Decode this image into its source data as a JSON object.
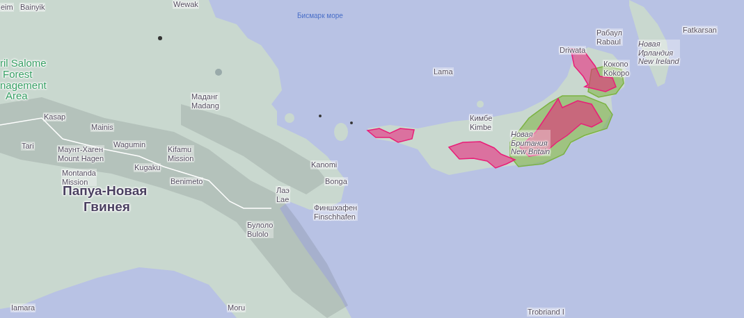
{
  "map": {
    "labels": [
      {
        "kind": "sea",
        "lines": [
          "Бисмарк море"
        ]
      },
      {
        "kind": "town",
        "lines": [
          "Wewak"
        ]
      },
      {
        "kind": "town",
        "lines": [
          "eim"
        ]
      },
      {
        "kind": "town",
        "lines": [
          "Bainyik"
        ]
      },
      {
        "kind": "park",
        "lines": [
          "ril Salome",
          "Forest",
          "nagement",
          "Area"
        ]
      },
      {
        "kind": "town",
        "lines": [
          "Маданг",
          "Madang"
        ]
      },
      {
        "kind": "town",
        "lines": [
          "Kasap"
        ]
      },
      {
        "kind": "town",
        "lines": [
          "Mainis"
        ]
      },
      {
        "kind": "town",
        "lines": [
          "Tari"
        ]
      },
      {
        "kind": "town",
        "lines": [
          "Маунт-Хаген",
          "Mount Hagen"
        ]
      },
      {
        "kind": "town",
        "lines": [
          "Wagumin"
        ]
      },
      {
        "kind": "town",
        "lines": [
          "Kifamu",
          "Mission"
        ]
      },
      {
        "kind": "town",
        "lines": [
          "Kugaku"
        ]
      },
      {
        "kind": "town",
        "lines": [
          "Montanda",
          "Mission"
        ]
      },
      {
        "kind": "town",
        "lines": [
          "Benimeto"
        ]
      },
      {
        "kind": "country",
        "lines": [
          "Папуа-Новая",
          "Гвинея"
        ]
      },
      {
        "kind": "town",
        "lines": [
          "Kanomi"
        ]
      },
      {
        "kind": "town",
        "lines": [
          "Bonga"
        ]
      },
      {
        "kind": "town",
        "lines": [
          "Лаэ",
          "Lae"
        ]
      },
      {
        "kind": "town",
        "lines": [
          "Финшхафен",
          "Finschhafen"
        ]
      },
      {
        "kind": "town",
        "lines": [
          "Булоло",
          "Bulolo"
        ]
      },
      {
        "kind": "town",
        "lines": [
          "Lama"
        ]
      },
      {
        "kind": "town",
        "lines": [
          "Кимбе",
          "Kimbe"
        ]
      },
      {
        "kind": "island",
        "lines": [
          "Новая",
          "Британия",
          "New Britain"
        ]
      },
      {
        "kind": "town",
        "lines": [
          "Рабаул",
          "Rabaul"
        ]
      },
      {
        "kind": "town",
        "lines": [
          "Driwata"
        ]
      },
      {
        "kind": "town",
        "lines": [
          "Кокопо",
          "Kokopo"
        ]
      },
      {
        "kind": "island",
        "lines": [
          "Новая",
          "Ирландия",
          "New Ireland"
        ]
      },
      {
        "kind": "town",
        "lines": [
          "Fatkarsan"
        ]
      },
      {
        "kind": "town",
        "lines": [
          "Iamara"
        ]
      },
      {
        "kind": "town",
        "lines": [
          "Moru"
        ]
      },
      {
        "kind": "town",
        "lines": [
          "Trobriand I"
        ]
      }
    ],
    "range_areas": [
      {
        "color": "#7cb342"
      },
      {
        "color": "#7cb342"
      },
      {
        "color": "#e91e78"
      },
      {
        "color": "#e91e78"
      },
      {
        "color": "#e91e78"
      },
      {
        "color": "#e91e78"
      }
    ]
  }
}
